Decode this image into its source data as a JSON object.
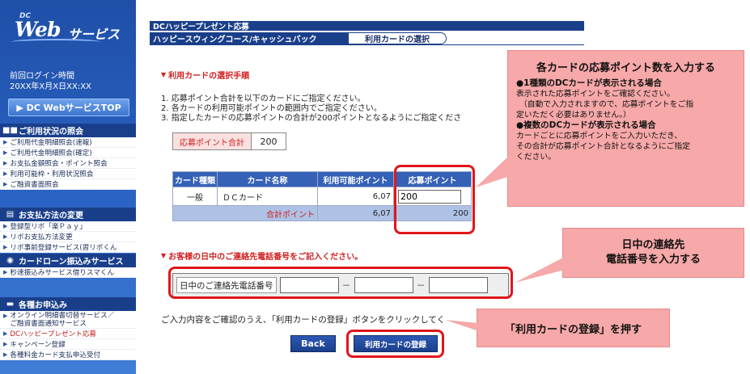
{
  "sidebar": {
    "logo_dc": "DC",
    "logo_web": "Web",
    "logo_service": "サービス",
    "login_label": "前回ログイン時間",
    "login_time": "20XX年X月X日XX:XX",
    "top_button": "▶ DC WebサービスTOP",
    "sections": [
      {
        "title": "ご利用状況の照会",
        "icon": "■■",
        "items": [
          "ご利用代金明細照会(速報)",
          "ご利用代金明細照会(確定)",
          "お支払金額照会・ポイント照会",
          "利用可能枠・利用状況照会",
          "ご融資書面照会"
        ]
      },
      {
        "title": "お支払方法の変更",
        "icon": "▤",
        "items": [
          "登録型リボ「楽Ｐａｙ」",
          "リボお支払方法変更",
          "リボ事前登録サービス(習リボくん"
        ]
      },
      {
        "title": "カードローン振込みサービス",
        "icon": "◉",
        "items": [
          "秒速振込みサービス借りスマくん"
        ]
      },
      {
        "title": "各種お申込み",
        "icon": "▬",
        "items": [
          "オンライン明細書切替サービス／",
          "ご融資書面通知サービス",
          "DCハッピープレゼント応募",
          "キャンペーン登録",
          "各種料金カード支払申込受付"
        ]
      }
    ]
  },
  "header": {
    "title": "DCハッピープレゼント応募",
    "tab1": "ハッピースウィングコース/キャッシュバック",
    "tab2": "利用カードの選択"
  },
  "section1": {
    "title": "利用カードの選択手順",
    "inst1": "1. 応募ポイント合計を以下のカードにご指定ください。",
    "inst2": "2. 各カードの利用可能ポイントの範囲内でご指定ください。",
    "inst3": "3. 指定したカードの応募ポイントの合計が200ポイントとなるようにご指定くださ",
    "total_label": "応募ポイント合計",
    "total_value": "200"
  },
  "table": {
    "headers": [
      "カード種類",
      "カード名称",
      "利用可能ポイント",
      "応募ポイント"
    ],
    "row": {
      "type": "一般",
      "name": "ＤＣカード",
      "available": "6,07",
      "apply": "200"
    },
    "sum": {
      "label": "合計ポイント",
      "available": "6,07",
      "apply": "200"
    }
  },
  "section2": {
    "title": "お客様の日中のご連絡先電話番号をご記入ください。",
    "phone_label": "日中のご連絡先電話番号",
    "dash": "－"
  },
  "confirm_text": "ご入力内容をご確認のうえ、「利用カードの登録」ボタンをクリックしてく",
  "buttons": {
    "back": "Back",
    "register": "利用カードの登録"
  },
  "annotations": {
    "a1_title": "各カードの応募ポイント数を入力する",
    "a1_b1": "●1種類のDCカードが表示される場合",
    "a1_l1": "表示された応募ポイントをご確認ください。",
    "a1_l2": "（自動で入力されますので、応募ポイントをご指",
    "a1_l3": "定いただく必要はありません。）",
    "a1_b2": "●複数のDCカードが表示される場合",
    "a1_l4": "カードごとに応募ポイントをご入力いただき、",
    "a1_l5": "その合計が応募ポイント合計となるようにご指定",
    "a1_l6": "ください。",
    "a2_l1": "日中の連絡先",
    "a2_l2": "電話番号を入力する",
    "a3": "「利用カードの登録」を押す"
  },
  "colors": {
    "navy": "#1a3f8a",
    "accent_red": "#d02020",
    "callout_pink": "#f7a8a8",
    "table_header": "#3561b7"
  }
}
